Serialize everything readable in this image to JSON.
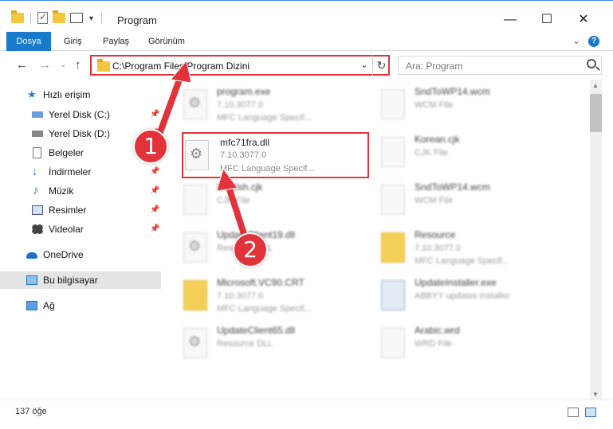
{
  "window": {
    "title": "Program"
  },
  "ribbon": {
    "tabs": [
      "Dosya",
      "Giriş",
      "Paylaş",
      "Görünüm"
    ]
  },
  "address": {
    "path": "C:\\Program Files\\Program Dizini"
  },
  "search": {
    "placeholder": "Ara: Program"
  },
  "sidebar": {
    "items": [
      {
        "label": "Hızlı erişim",
        "icon": "star-icon"
      },
      {
        "label": "Yerel Disk (C:)",
        "icon": "drive-icon",
        "pinned": true
      },
      {
        "label": "Yerel Disk (D:)",
        "icon": "drive-icon",
        "pinned": true
      },
      {
        "label": "Belgeler",
        "icon": "document-icon",
        "pinned": true
      },
      {
        "label": "İndirmeler",
        "icon": "download-icon",
        "pinned": true
      },
      {
        "label": "Müzik",
        "icon": "music-icon",
        "pinned": true
      },
      {
        "label": "Resimler",
        "icon": "pictures-icon",
        "pinned": true
      },
      {
        "label": "Videolar",
        "icon": "video-icon",
        "pinned": true
      },
      {
        "label": "OneDrive",
        "icon": "cloud-icon"
      },
      {
        "label": "Bu bilgisayar",
        "icon": "computer-icon",
        "selected": true
      },
      {
        "label": "Ağ",
        "icon": "network-icon"
      }
    ]
  },
  "files": [
    {
      "name": "program.exe",
      "line1": "7.10.3077.0",
      "line2": "MFC Language Specif...",
      "icon": "gear"
    },
    {
      "name": "SndToWP14.wcm",
      "line1": "WCM File",
      "line2": "",
      "icon": "blank"
    },
    {
      "name": "mfc71fra.dll",
      "line1": "7.10.3077.0",
      "line2": "MFC Language Specif...",
      "icon": "gear"
    },
    {
      "name": "Korean.cjk",
      "line1": "CJK File",
      "line2": "",
      "icon": "blank"
    },
    {
      "name": "English.cjk",
      "line1": "CJK File",
      "line2": "",
      "icon": "blank"
    },
    {
      "name": "SndToWP14.wcm",
      "line1": "WCM File",
      "line2": "",
      "icon": "blank"
    },
    {
      "name": "UpdateClient19.dll",
      "line1": "Resource DLL",
      "line2": "",
      "icon": "gear"
    },
    {
      "name": "Resource",
      "line1": "7.10.3077.0",
      "line2": "MFC Language Specif...",
      "icon": "folder"
    },
    {
      "name": "Microsoft.VC90.CRT",
      "line1": "7.10.3077.0",
      "line2": "MFC Language Specif...",
      "icon": "folder"
    },
    {
      "name": "UpdateInstaller.exe",
      "line1": "ABBYY updates installer",
      "line2": "",
      "icon": "app"
    },
    {
      "name": "UpdateClient65.dll",
      "line1": "Resource DLL",
      "line2": "",
      "icon": "gear"
    },
    {
      "name": "Arabic.wrd",
      "line1": "WRD File",
      "line2": "",
      "icon": "blank"
    }
  ],
  "status": {
    "count": "137 öğe"
  },
  "annotations": {
    "step1": "1",
    "step2": "2",
    "color": "#e2333b"
  }
}
